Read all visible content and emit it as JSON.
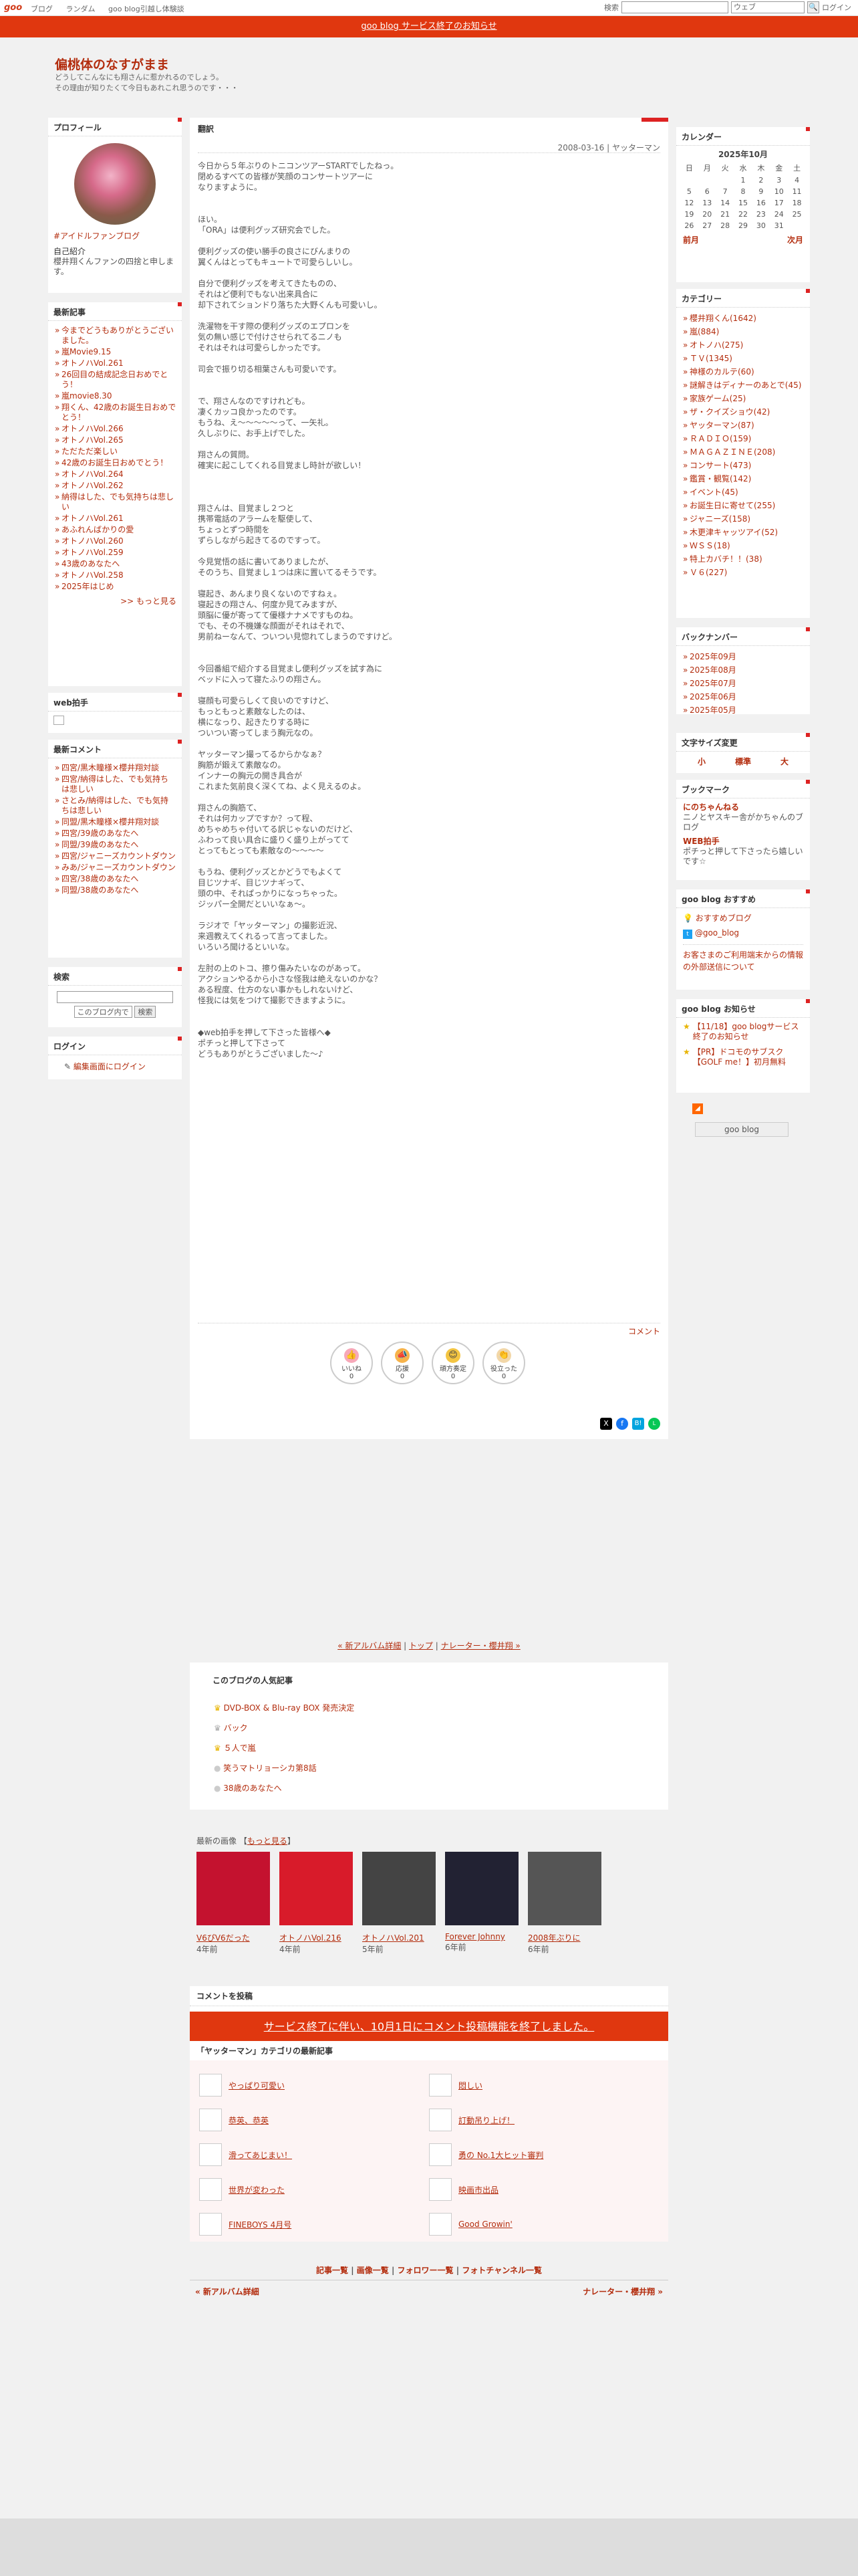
{
  "topbar": {
    "logo": "goo",
    "links": [
      "ブログ",
      "ランダム",
      "goo blog引越し体験談"
    ],
    "search_label": "検索",
    "search_select": "ウェブ",
    "login": "ログイン"
  },
  "notice": "goo blog サービス終了のお知らせ",
  "header": {
    "title": "偏桃体のなすがまま",
    "desc1": "どうしてこんなにも翔さんに惹かれるのでしょう。",
    "desc2": "その理由が知りたくて今日もあれこれ思うのです・・・"
  },
  "profile": {
    "heading": "プロフィール",
    "link": "#アイドルファンブログ",
    "intro_title": "自己紹介",
    "intro": "櫻井翔くんファンの四捨と申します。"
  },
  "recent": {
    "heading": "最新記事",
    "items": [
      "今までどうもありがとうございました。",
      "嵐Movie9.15",
      "オトノハVol.261",
      "26回目の結成記念日おめでとう！",
      "嵐movie8.30",
      "翔くん、42歳のお誕生日おめでとう！",
      "オトノハVol.266",
      "オトノハVol.265",
      "ただただ楽しい",
      "42歳のお誕生日おめでとう！",
      "オトノハVol.264",
      "オトノハVol.262",
      "納得はした、でも気持ちは悲しい",
      "オトノハVol.261",
      "あふれんばかりの愛",
      "オトノハVol.260",
      "オトノハVol.259",
      "43歳のあなたへ",
      "オトノハVol.258",
      "2025年はじめ"
    ],
    "more": ">> もっと見る"
  },
  "web_clap": {
    "heading": "web拍手"
  },
  "comments": {
    "heading": "最新コメント",
    "items": [
      "四宮/黒木瞳様×櫻井翔対談",
      "四宮/納得はした、でも気持ちは悲しい",
      "さとみ/納得はした、でも気持ちは悲しい",
      "同盟/黒木瞳様×櫻井翔対談",
      "四宮/39歳のあなたへ",
      "同盟/39歳のあなたへ",
      "四宮/ジャニーズカウントダウン",
      "みあ/ジャニーズカウントダウン",
      "四宮/38歳のあなたへ",
      "同盟/38歳のあなたへ"
    ]
  },
  "search": {
    "heading": "検索",
    "scope": "このブログ内で",
    "button": "検索"
  },
  "login_box": {
    "heading": "ログイン",
    "link": "編集画面にログイン"
  },
  "post": {
    "category": "翻訳",
    "date": "2008-03-16 | ヤッターマン",
    "body": "今日から５年ぶりのトニコンツアーSTARTでしたねっ。\n閉めるすべての皆様が笑顔のコンサートツアーに\nなりますように。\n\n\nほい。\n「ORA」は便利グッズ研究会でした。\n\n便利グッズの使い勝手の良さにびんまりの\n翼くんはとってもキュートで可愛らしいし。\n\n自分で便利グッズを考えてきたものの、\nそれはど便利でもない出来具合に\n却下されてションドり落ちた大野くんも可愛いし。\n\n洗濯物を干す際の便利グッズのエプロンを\n気の無い感じで付けさせられてるニノも\nそれはそれは可愛らしかったです。\n\n司会で振り切る相葉さんも可愛いです。\n\n\nで、翔さんなのですけれども。\n凄くカッコ良かったのです。\nもうね、え〜〜〜〜〜って、一矢礼。\n久しぶりに、お手上げでした。\n\n翔さんの質問。\n確実に起こしてくれる目覚まし時計が欲しい！\n\n\n\n翔さんは、目覚まし２つと\n携帯電話のアラームを駆使して、\nちょっとずつ時間を\nずらしながら起きてるのですって。\n\n今見覚悟の話に書いてありましたが、\nそのうち、目覚まし１つは床に置いてるそうです。\n\n寝起き、あんまり良くないのですねぇ。\n寝起きの翔さん、何度か見てみますが、\n頭脳に優が寄ってて優様ナナメですものね。\nでも、その不機嫌な顔面がそれはそれで、\n男前ねーなんて、ついつい見惚れてしまうのですけど。\n\n\n今回番組で紹介する目覚まし便利グッズを試す為に\nベッドに入って寝たふりの翔さん。\n\n寝顔も可愛らしくて良いのですけど、\nもっともっと素敵なしたのは、\n横になっり、起きたりする時に\nついつい寄ってしまう胸元なの。\n\nヤッターマン撮ってるからかなぁ？\n胸筋が鍛えて素敵なの。\nインナーの胸元の開き具合が\nこれまた気前良く深くてね、よく見えるのよ。\n\n翔さんの胸筋て、\nそれは何カップですか？って程、\nめちゃめちゃ付いてる訳じゃないのだけど、\nふわって良い具合に盛りく盛り上がってて\nとってもとっても素敵なの〜〜〜〜\n\nもうね、便利グッズとかどうでもよくて\n目じツナギ、目じツナギって、\n頭の中、それぱっかりになっちゃった。\nジッパー全開だといいなぁ〜。\n\nラジオで「ヤッターマン」の撮影近況、\n来週教えてくれるって言ってました。\nいろいろ聞けるといいな。\n\n左肘の上のトコ、擦り傷みたいなのがあって。\nアクションやるから小さな怪我は絶えないのかな？\nある程度、仕方のない事かもしれないけど、\n怪我には気をつけて撮影できますように。\n\n\n◆web拍手を押して下さった皆様へ◆\nポチっと押して下さって\nどうもありがとうございました〜♪",
    "comment_link": "コメント"
  },
  "reactions": [
    {
      "label": "いいね",
      "count": "0",
      "icon": "thumb-icon"
    },
    {
      "label": "応援",
      "count": "0",
      "icon": "megaphone-icon"
    },
    {
      "label": "頑方奏定",
      "count": "0",
      "icon": "smile-icon"
    },
    {
      "label": "役立った",
      "count": "0",
      "icon": "clap-icon"
    }
  ],
  "calendar": {
    "heading": "カレンダー",
    "month": "2025年10月",
    "dow": [
      "日",
      "月",
      "火",
      "水",
      "木",
      "金",
      "土"
    ],
    "days": [
      "",
      "",
      "",
      "1",
      "2",
      "3",
      "4",
      "5",
      "6",
      "7",
      "8",
      "9",
      "10",
      "11",
      "12",
      "13",
      "14",
      "15",
      "16",
      "17",
      "18",
      "19",
      "20",
      "21",
      "22",
      "23",
      "24",
      "25",
      "26",
      "27",
      "28",
      "29",
      "30",
      "31",
      ""
    ],
    "prev": "前月",
    "next": "次月"
  },
  "categories": {
    "heading": "カテゴリー",
    "items": [
      "櫻井翔くん(1642)",
      "嵐(884)",
      "オトノハ(275)",
      "ＴＶ(1345)",
      "神様のカルテ(60)",
      "謎解きはディナーのあとで(45)",
      "家族ゲーム(25)",
      "ザ・クイズショウ(42)",
      "ヤッターマン(87)",
      "ＲＡＤＩＯ(159)",
      "ＭＡＧＡＺＩＮＥ(208)",
      "コンサート(473)",
      "鑑賞・観覧(142)",
      "イベント(45)",
      "お誕生日に寄せて(255)",
      "ジャニーズ(158)",
      "木更津キャッツアイ(52)",
      "ＷＳＳ(18)",
      "特上カバチ！！(38)",
      "Ｖ６(227)"
    ]
  },
  "backnumber": {
    "heading": "バックナンバー",
    "items": [
      "2025年09月",
      "2025年08月",
      "2025年07月",
      "2025年06月",
      "2025年05月"
    ]
  },
  "fontsize": {
    "heading": "文字サイズ変更",
    "small": "小",
    "mid": "標準",
    "large": "大"
  },
  "bookmark": {
    "heading": "ブックマーク",
    "items": [
      {
        "t": "にのちゃんねる",
        "d": "ニノとヤスキー舎がかちゃんのブログ"
      },
      {
        "t": "WEB拍手",
        "d": "ポチっと押して下さったら嬉しいです☆"
      }
    ]
  },
  "goo_rec": {
    "heading": "goo blog おすすめ",
    "items": [
      "おすすめブログ",
      "@goo_blog"
    ],
    "note": "お客さまのご利用端末からの情報の外部送信について"
  },
  "goo_news": {
    "heading": "goo blog お知らせ",
    "items": [
      "【11/18】goo blogサービス終了のお知らせ",
      "【PR】ドコモのサブスク【GOLF me！】初月無料"
    ],
    "badge": "goo blog"
  },
  "nav": {
    "prev": "« 新アルバム詳細",
    "top": "トップ",
    "next": "ナレーター・櫻井翔 »"
  },
  "popular": {
    "heading": "このブログの人気記事",
    "items": [
      "DVD-BOX & Blu-ray BOX 発売決定",
      "バック",
      "５人で嵐",
      "笑うマトリョーシカ第8話",
      "38歳のあなたへ"
    ]
  },
  "gallery": {
    "heading": "最新の画像",
    "more": "もっと見る",
    "items": [
      {
        "t": "V6ぴV6だった",
        "d": "4年前"
      },
      {
        "t": "オトノハVol.216",
        "d": "4年前"
      },
      {
        "t": "オトノハVol.201",
        "d": "5年前"
      },
      {
        "t": "Forever Johnny",
        "d": "6年前"
      },
      {
        "t": "2008年ぶりに",
        "d": "6年前"
      }
    ]
  },
  "comment_post": {
    "heading": "コメントを投稿",
    "banner": "サービス終了に伴い、10月1日にコメント投稿機能を終了しました。"
  },
  "related": {
    "heading": "「ヤッターマン」カテゴリの最新記事",
    "left": [
      "やっぱり可愛い",
      "恭英、恭英",
      "滑ってあじまい！",
      "世界が変わった",
      "FINEBOYS 4月号"
    ],
    "right": [
      "悶しい",
      "訂動吊り上げ！",
      "勇の No.1大ヒット審判",
      "映画市出品",
      "Good Growin'"
    ]
  },
  "footer_links": {
    "a": "記事一覧",
    "b": "画像一覧",
    "c": "フォロワー一覧",
    "d": "フォトチャンネル一覧",
    "prev": "« 新アルバム詳細",
    "next": "ナレーター・櫻井翔 »"
  }
}
